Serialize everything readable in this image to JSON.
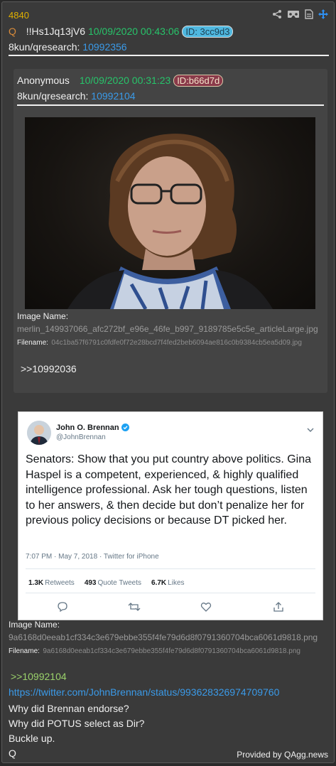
{
  "post": {
    "number": "4840",
    "q_label": "Q",
    "tripcode": "!!Hs1Jq13jV6",
    "datetime": "10/09/2020 00:43:06",
    "id_label": "ID: 3cc9d3",
    "id_color": "#4fb8e0",
    "board_prefix": "8kun/qresearch:",
    "board_link": "10992356",
    "icons": [
      "share-icon",
      "vr-icon",
      "document-icon",
      "move-icon"
    ]
  },
  "quoted": {
    "author": "Anonymous",
    "datetime": "10/09/2020 00:31:23",
    "id_label": "ID:b66d7d",
    "id_color": "#8a3a4a",
    "board_prefix": "8kun/qresearch:",
    "board_link": "10992104",
    "image_name_label": "Image Name:",
    "image_name": "merlin_149937066_afc272bf_e96e_46fe_b997_9189785e5c5e_articleLarge.jpg",
    "filename_label": "Filename:",
    "filename": "04c1ba57f6791c0fdfe0f72e28bcd7f4fed2beb6094ae816c0b9384cb5ea5d09.jpg",
    "reply_ref": ">>10992036"
  },
  "tweet": {
    "name": "John O. Brennan",
    "handle": "@JohnBrennan",
    "text": "Senators: Show that you put country above politics. Gina Haspel is a competent, experienced, & highly qualified intelligence professional. Ask her tough questions, listen to her answers, & then decide but don’t penalize her for previous policy decisions or because DT picked her.",
    "meta": "7:07 PM · May 7, 2018 · Twitter for iPhone",
    "retweets_count": "1.3K",
    "retweets_label": "Retweets",
    "quotes_count": "493",
    "quotes_label": "Quote Tweets",
    "likes_count": "6.7K",
    "likes_label": "Likes"
  },
  "tweet_image": {
    "image_name_label": "Image Name:",
    "image_name": "9a6168d0eeab1cf334c3e679ebbe355f4fe79d6d8f0791360704bca6061d9818.png",
    "filename_label": "Filename:",
    "filename": "9a6168d0eeab1cf334c3e679ebbe355f4fe79d6d8f0791360704bca6061d9818.png"
  },
  "body": {
    "reply_ref": ">>10992104",
    "url": "https://twitter.com/JohnBrennan/status/993628326974709760",
    "lines": [
      "Why did Brennan endorse?",
      "Why did POTUS select as Dir?",
      "Buckle up.",
      "Q"
    ]
  },
  "credit": "Provided by QAgg.news"
}
